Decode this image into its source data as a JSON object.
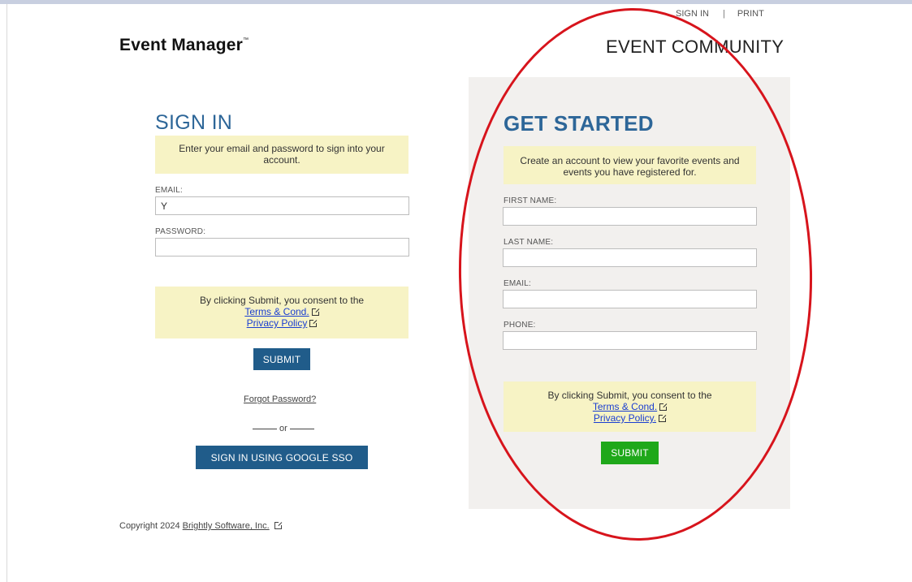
{
  "top_nav": {
    "sign_in": "SIGN IN",
    "separator": "|",
    "print": "PRINT"
  },
  "brand": {
    "name": "Event Manager",
    "trademark": "™"
  },
  "community_title": "EVENT COMMUNITY",
  "sign_in": {
    "heading": "SIGN IN",
    "notice": "Enter your email and password to sign into your account.",
    "email_label": "EMAIL:",
    "email_value": "Y",
    "password_label": "PASSWORD:",
    "password_value": "",
    "consent_text": "By clicking Submit, you consent to the",
    "terms_link": "Terms & Cond.",
    "privacy_link": "Privacy Policy",
    "submit_label": "SUBMIT",
    "forgot_password": "Forgot Password?",
    "or_text": "or",
    "google_sso_label": "SIGN IN USING GOOGLE SSO"
  },
  "get_started": {
    "heading": "GET STARTED",
    "notice": "Create an account to view your favorite events and events you have registered for.",
    "first_name_label": "FIRST NAME:",
    "last_name_label": "LAST NAME:",
    "email_label": "EMAIL:",
    "phone_label": "PHONE:",
    "consent_text": "By clicking Submit, you consent to the",
    "terms_link": "Terms & Cond.",
    "privacy_link": "Privacy Policy.",
    "submit_label": "SUBMIT"
  },
  "footer": {
    "copyright_prefix": "Copyright 2024",
    "company_link": "Brightly Software, Inc."
  },
  "annotation": {
    "oval_color": "#d7141c"
  },
  "colors": {
    "accent_blue": "#205c8a",
    "heading_blue": "#2d6698",
    "submit_green": "#1fa81a",
    "notice_yellow": "#f7f3c5",
    "panel_gray": "#f2f0ee"
  }
}
